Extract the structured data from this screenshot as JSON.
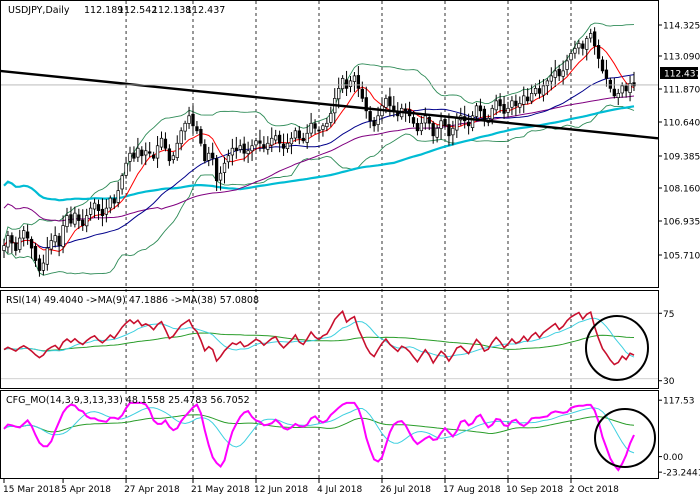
{
  "chart_data": [
    {
      "type": "candlestick",
      "header": {
        "symbol": "USDJPY,Daily",
        "ohlc": [
          "112.189",
          "112.542",
          "112.138",
          "112.437"
        ]
      },
      "last_price": "112.437",
      "ylim": [
        104.5,
        115.2
      ],
      "y_ticks": [
        "114.325",
        "113.090",
        "111.870",
        "110.640",
        "109.385",
        "108.160",
        "106.935",
        "105.710"
      ],
      "x_labels": [
        "15 Mar 2018",
        "5 Apr 2018",
        "27 Apr 2018",
        "21 May 2018",
        "12 Jun 2018",
        "4 Jul 2018",
        "26 Jul 2018",
        "17 Aug 2018",
        "10 Sep 2018",
        "2 Oct 2018"
      ],
      "vertical_grid_on_labels": [
        2,
        3,
        4,
        5,
        6,
        7,
        8,
        9
      ],
      "moving_averages": {
        "fast": {
          "color": "#ff0000"
        },
        "medium": {
          "color": "#00008b"
        },
        "slow": {
          "color": "#800080"
        },
        "long": {
          "color": "#00bcd4"
        }
      },
      "bollinger_color": "#2e8b57",
      "trendline": {
        "from": [
          0,
          113.0
        ],
        "to": [
          199,
          110.3
        ],
        "color": "#000000"
      },
      "current_price_line": 112.437,
      "series_close": [
        106.0,
        106.4,
        106.1,
        105.8,
        106.3,
        106.6,
        106.3,
        105.9,
        105.4,
        105.0,
        105.3,
        105.9,
        106.2,
        106.4,
        106.0,
        106.8,
        107.2,
        106.9,
        107.3,
        107.0,
        106.8,
        107.2,
        107.5,
        107.7,
        107.4,
        107.2,
        107.5,
        107.9,
        107.7,
        108.2,
        108.8,
        109.3,
        109.7,
        109.5,
        109.9,
        109.6,
        109.8,
        109.7,
        109.5,
        110.0,
        110.3,
        109.9,
        109.4,
        109.6,
        110.1,
        110.6,
        110.9,
        111.2,
        110.8,
        110.6,
        110.1,
        109.4,
        109.7,
        109.5,
        108.6,
        108.9,
        109.3,
        109.6,
        109.9,
        109.8,
        110.0,
        109.7,
        109.8,
        110.0,
        110.2,
        110.1,
        109.9,
        110.1,
        110.3,
        110.4,
        110.1,
        109.9,
        110.1,
        110.3,
        110.6,
        110.3,
        110.2,
        110.5,
        110.9,
        110.7,
        110.6,
        110.8,
        110.9,
        111.3,
        111.9,
        112.3,
        112.7,
        112.3,
        112.6,
        112.8,
        112.3,
        111.9,
        111.4,
        111.0,
        110.8,
        111.2,
        111.6,
        111.9,
        111.6,
        111.4,
        111.2,
        111.5,
        111.4,
        111.2,
        110.9,
        110.6,
        110.9,
        111.2,
        110.9,
        110.4,
        110.7,
        111.0,
        110.8,
        110.4,
        110.7,
        111.1,
        111.2,
        111.0,
        110.8,
        111.2,
        111.6,
        111.4,
        111.0,
        111.1,
        111.5,
        111.8,
        111.6,
        111.3,
        111.5,
        111.8,
        111.6,
        111.7,
        112.0,
        111.8,
        112.1,
        112.3,
        112.1,
        112.4,
        112.6,
        112.8,
        113.0,
        112.8,
        113.0,
        113.4,
        113.7,
        113.9,
        114.1,
        113.9,
        114.3,
        114.5,
        114.0,
        113.5,
        113.0,
        112.7,
        112.3,
        112.0,
        112.1,
        112.4,
        112.2,
        112.5,
        112.4
      ],
      "rsi_panel": {
        "header": "RSI(14) 49.4040  ->MA(9) 47.1886  ->MA(38) 57.0808",
        "ylim": [
          25,
          80
        ],
        "y_ticks": [
          "75",
          "30"
        ],
        "levels": [
          75,
          30
        ],
        "colors": {
          "rsi": "#c8102e",
          "ma_fast": "#3fd0e0",
          "ma_slow": "#2a9d2a"
        },
        "highlight_circle": true
      },
      "cfg_panel": {
        "header": "CFG_MO(14,3,9,3,13,33) 48.1558 25.4783 56.7052",
        "ylim": [
          -35,
          130
        ],
        "y_ticks": [
          "117.53",
          "0.00",
          "-23.2441"
        ],
        "colors": {
          "main": "#ff00ff",
          "signal": "#3fd0e0",
          "slow": "#2a9d2a"
        },
        "highlight_circle": true
      }
    }
  ]
}
